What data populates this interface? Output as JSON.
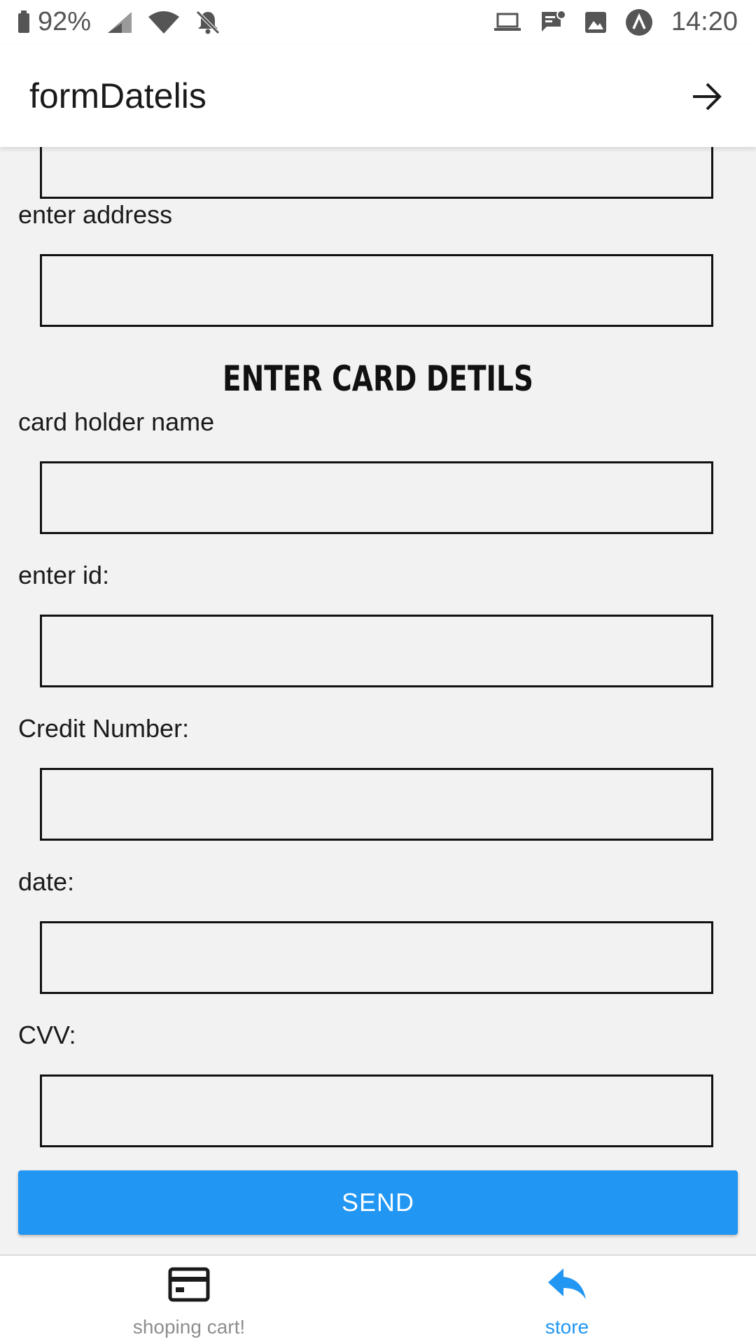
{
  "status_bar": {
    "battery_percent": "92%",
    "time": "14:20",
    "icons": [
      "battery-icon",
      "cell-signal-icon",
      "wifi-icon",
      "notifications-off-icon",
      "laptop-icon",
      "message-icon",
      "image-icon",
      "app-icon"
    ]
  },
  "app_bar": {
    "title": "formDatelis",
    "action_icon": "arrow-forward-icon"
  },
  "form": {
    "address_label": "enter address",
    "section_title": "ENTER CARD DETILS",
    "card_holder_label": "card holder name",
    "id_label": "enter id:",
    "credit_number_label": "Credit Number:",
    "date_label": "date:",
    "cvv_label": "CVV:",
    "previous_field_value": "",
    "address_value": "",
    "card_holder_value": "",
    "id_value": "",
    "credit_number_value": "",
    "date_value": "",
    "cvv_value": ""
  },
  "send_button": {
    "label": "SEND",
    "color": "#2196f3"
  },
  "tabs": [
    {
      "label": "shoping cart!",
      "icon": "credit-card-icon",
      "active": false
    },
    {
      "label": "store",
      "icon": "reply-icon",
      "active": true
    }
  ],
  "colors": {
    "accent": "#2196f3",
    "background": "#f2f2f2",
    "inactive_tab": "#8e8e8e"
  }
}
